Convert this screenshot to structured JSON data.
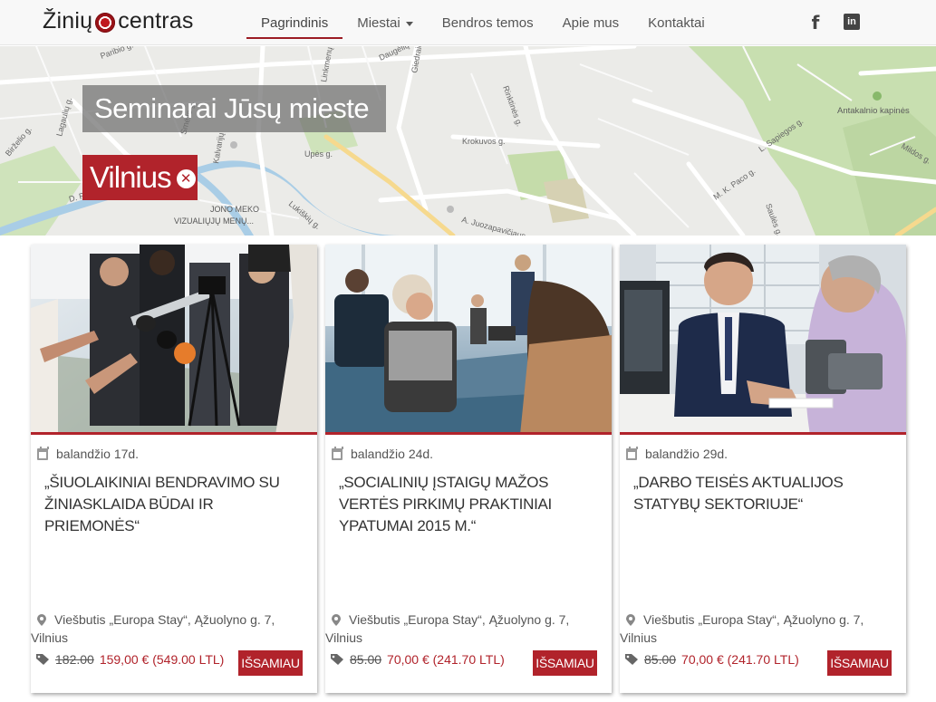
{
  "brand": {
    "name_part1": "Žinių",
    "name_part2": "centras"
  },
  "nav": {
    "items": [
      {
        "label": "Pagrindinis",
        "active": true
      },
      {
        "label": "Miestai",
        "dropdown": true
      },
      {
        "label": "Bendros temos"
      },
      {
        "label": "Apie mus"
      },
      {
        "label": "Kontaktai"
      }
    ],
    "social": {
      "facebook": "f",
      "linkedin": "in"
    }
  },
  "hero": {
    "title": "Seminarai Jūsų mieste",
    "city": "Vilnius",
    "city_close": "✕",
    "map_labels": [
      "Paribio g.",
      "Daugėlių",
      "Giedraičių g.",
      "Linkmenų",
      "Rinktinės g.",
      "Antakalnio kapinės",
      "Lagaulių g.",
      "Birželio g.",
      "Smėlio g.",
      "Kalvarijų",
      "Krokuvos g.",
      "Upės g.",
      "L. Sapiegos g.",
      "Mildos g.",
      "M. K. Paco g.",
      "Saulės g.",
      "D. Poškos g.",
      "Žalgirio",
      "Lukiškių g.",
      "A. Juozapavičiaus g.",
      "JONO MEKO",
      "VIZUALIŲJŲ MENŲ..."
    ]
  },
  "colors": {
    "accent": "#b1232b",
    "nav_bg": "#f8f8f8"
  },
  "cards": [
    {
      "date": "balandžio 17d.",
      "title": "„ŠIUOLAIKINIAI BENDRAVIMO SU ŽINIASKLAIDA BŪDAI IR PRIEMONĖS“",
      "location": "Viešbutis „Europa Stay“, Ąžuolyno g. 7, Vilnius",
      "old_price": "182.00",
      "new_price": "159,00 € (549.00 LTL)",
      "button": "IŠSAMIAU"
    },
    {
      "date": "balandžio 24d.",
      "title": "„SOCIALINIŲ ĮSTAIGŲ MAŽOS VERTĖS PIRKIMŲ PRAKTINIAI YPATUMAI 2015 M.“",
      "location": "Viešbutis „Europa Stay“, Ąžuolyno g. 7, Vilnius",
      "old_price": "85.00",
      "new_price": "70,00 € (241.70 LTL)",
      "button": "IŠSAMIAU"
    },
    {
      "date": "balandžio 29d.",
      "title": "„DARBO TEISĖS AKTUALIJOS STATYBŲ SEKTORIUJE“",
      "location": "Viešbutis „Europa Stay“, Ąžuolyno g. 7, Vilnius",
      "old_price": "85.00",
      "new_price": "70,00 € (241.70 LTL)",
      "button": "IŠSAMIAU"
    }
  ]
}
